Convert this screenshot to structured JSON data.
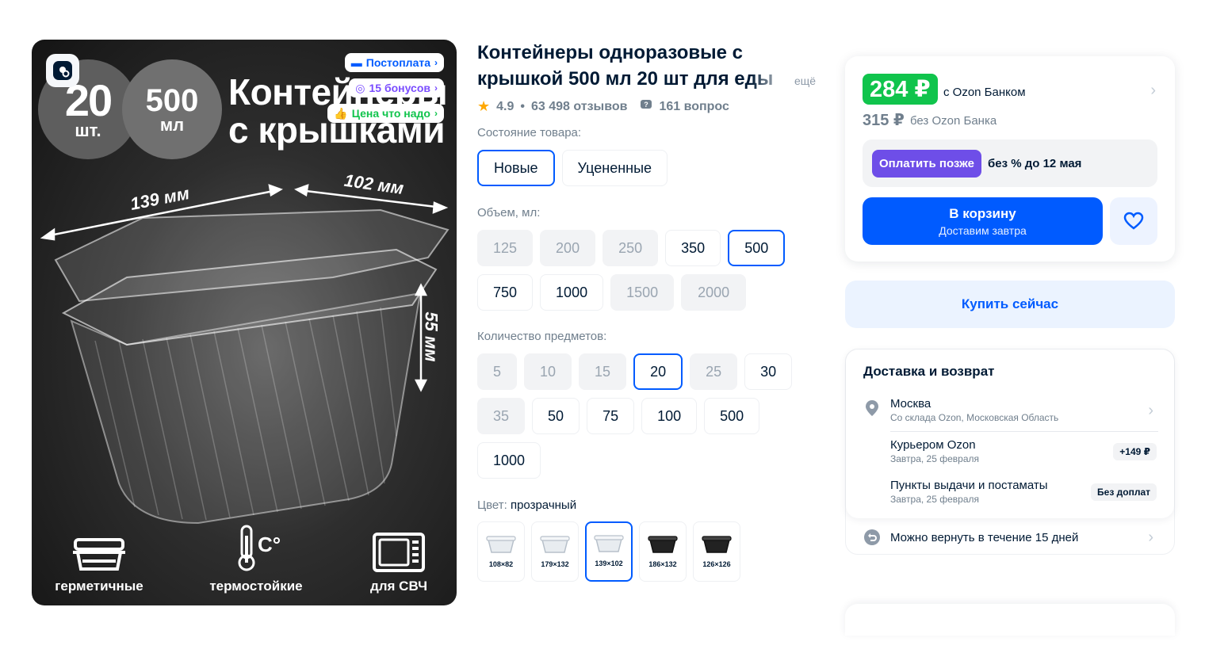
{
  "gallery": {
    "badges": [
      {
        "label": "Постоплата",
        "color": "#005bff"
      },
      {
        "label": "15 бонусов",
        "color": "#7a4dff"
      },
      {
        "label": "Цена что надо",
        "color": "#10c44c"
      }
    ],
    "count_number": "20",
    "count_unit": "шт.",
    "volume_number": "500",
    "volume_unit": "мл",
    "headline_line1": "Контейнеры",
    "headline_line2": "с крышками",
    "dim_length": "139 мм",
    "dim_width": "102 мм",
    "dim_height": "55 мм",
    "features": [
      {
        "label": "герметичные",
        "icon": "container-icon"
      },
      {
        "label": "термостойкие",
        "icon": "thermometer-icon"
      },
      {
        "label": "для СВЧ",
        "icon": "microwave-icon"
      }
    ]
  },
  "product": {
    "title": "Контейнеры одноразовые с крышкой 500 мл 20 шт для еды",
    "title_more": "ещё",
    "rating": "4.9",
    "reviews": "63 498 отзывов",
    "questions": "161 вопрос",
    "condition_label": "Состояние товара:",
    "condition_options": [
      {
        "label": "Новые",
        "state": "selected"
      },
      {
        "label": "Уцененные",
        "state": "normal"
      }
    ],
    "volume_label": "Объем, мл:",
    "volume_options": [
      {
        "label": "125",
        "state": "disabled"
      },
      {
        "label": "200",
        "state": "disabled"
      },
      {
        "label": "250",
        "state": "disabled"
      },
      {
        "label": "350",
        "state": "normal"
      },
      {
        "label": "500",
        "state": "selected"
      },
      {
        "label": "750",
        "state": "normal"
      },
      {
        "label": "1000",
        "state": "normal"
      },
      {
        "label": "1500",
        "state": "disabled"
      },
      {
        "label": "2000",
        "state": "disabled"
      }
    ],
    "qty_label": "Количество предметов:",
    "qty_options": [
      {
        "label": "5",
        "state": "disabled"
      },
      {
        "label": "10",
        "state": "disabled"
      },
      {
        "label": "15",
        "state": "disabled"
      },
      {
        "label": "20",
        "state": "selected"
      },
      {
        "label": "25",
        "state": "disabled"
      },
      {
        "label": "30",
        "state": "normal"
      },
      {
        "label": "35",
        "state": "disabled"
      },
      {
        "label": "50",
        "state": "normal"
      },
      {
        "label": "75",
        "state": "normal"
      },
      {
        "label": "100",
        "state": "normal"
      },
      {
        "label": "500",
        "state": "normal"
      },
      {
        "label": "1000",
        "state": "normal"
      }
    ],
    "color_label": "Цвет:",
    "color_value": "прозрачный",
    "color_swatches": [
      {
        "label": "108×82",
        "tone": "clear",
        "state": "normal"
      },
      {
        "label": "179×132",
        "tone": "clear",
        "state": "normal"
      },
      {
        "label": "139×102",
        "tone": "clear",
        "state": "selected"
      },
      {
        "label": "186×132",
        "tone": "black",
        "state": "normal"
      },
      {
        "label": "126×126",
        "tone": "black",
        "state": "normal"
      }
    ]
  },
  "price": {
    "card_price": "284 ₽",
    "card_note": "с Ozon Банком",
    "regular_price": "315 ₽",
    "regular_note": "без Ozon Банка",
    "pay_later_button": "Оплатить позже",
    "pay_later_text": "без % до 12 мая",
    "cart_label": "В корзину",
    "cart_sub": "Доставим завтра",
    "buy_now": "Купить сейчас",
    "colors": {
      "accent": "#005bff",
      "green": "#10c44c",
      "purple": "#6e4ee8"
    }
  },
  "delivery": {
    "title": "Доставка и возврат",
    "city": "Москва",
    "city_sub": "Со склада Ozon, Московская Область",
    "courier": "Курьером Ozon",
    "courier_sub": "Завтра, 25 февраля",
    "courier_tag": "+149 ₽",
    "pickup": "Пункты выдачи и постаматы",
    "pickup_sub": "Завтра, 25 февраля",
    "pickup_tag": "Без доплат",
    "return_text": "Можно вернуть в течение 15 дней"
  }
}
